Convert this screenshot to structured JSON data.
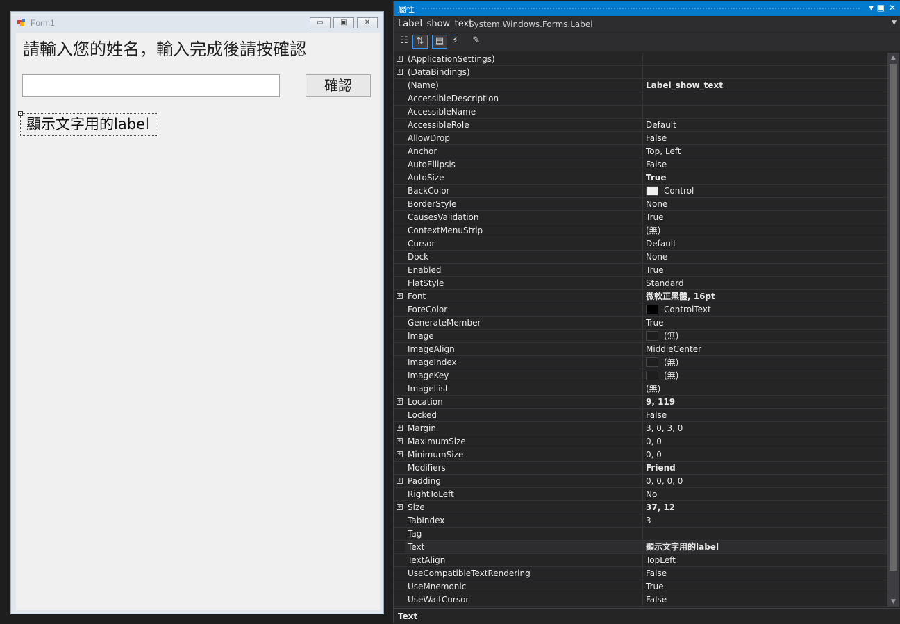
{
  "form": {
    "title": "Form1",
    "minimize_glyph": "▭",
    "maximize_glyph": "▣",
    "close_glyph": "✕",
    "prompt": "請輸入您的姓名，輸入完成後請按確認",
    "input_value": "",
    "confirm_label": "確認",
    "show_label": "顯示文字用的label"
  },
  "properties": {
    "panel_title": "屬性",
    "object_name": "Label_show_text",
    "object_type": "System.Windows.Forms.Label",
    "description_title": "Text",
    "rows": [
      {
        "name": "(ApplicationSettings)",
        "value": "",
        "expandable": true
      },
      {
        "name": "(DataBindings)",
        "value": "",
        "expandable": true
      },
      {
        "name": "(Name)",
        "value": "Label_show_text",
        "bold": true
      },
      {
        "name": "AccessibleDescription",
        "value": ""
      },
      {
        "name": "AccessibleName",
        "value": ""
      },
      {
        "name": "AccessibleRole",
        "value": "Default"
      },
      {
        "name": "AllowDrop",
        "value": "False"
      },
      {
        "name": "Anchor",
        "value": "Top, Left"
      },
      {
        "name": "AutoEllipsis",
        "value": "False"
      },
      {
        "name": "AutoSize",
        "value": "True",
        "bold": true
      },
      {
        "name": "BackColor",
        "value": "Control",
        "swatch": "#f0f0f0"
      },
      {
        "name": "BorderStyle",
        "value": "None"
      },
      {
        "name": "CausesValidation",
        "value": "True"
      },
      {
        "name": "ContextMenuStrip",
        "value": "(無)"
      },
      {
        "name": "Cursor",
        "value": "Default"
      },
      {
        "name": "Dock",
        "value": "None"
      },
      {
        "name": "Enabled",
        "value": "True"
      },
      {
        "name": "FlatStyle",
        "value": "Standard"
      },
      {
        "name": "Font",
        "value": "微軟正黑體, 16pt",
        "expandable": true,
        "bold": true
      },
      {
        "name": "ForeColor",
        "value": "ControlText",
        "swatch": "#000000"
      },
      {
        "name": "GenerateMember",
        "value": "True"
      },
      {
        "name": "Image",
        "value": "(無)",
        "swatch": "#1e1e1e"
      },
      {
        "name": "ImageAlign",
        "value": "MiddleCenter"
      },
      {
        "name": "ImageIndex",
        "value": "(無)",
        "swatch": "#1e1e1e"
      },
      {
        "name": "ImageKey",
        "value": "(無)",
        "swatch": "#1e1e1e"
      },
      {
        "name": "ImageList",
        "value": "(無)"
      },
      {
        "name": "Location",
        "value": "9, 119",
        "expandable": true,
        "bold": true
      },
      {
        "name": "Locked",
        "value": "False"
      },
      {
        "name": "Margin",
        "value": "3, 0, 3, 0",
        "expandable": true
      },
      {
        "name": "MaximumSize",
        "value": "0, 0",
        "expandable": true
      },
      {
        "name": "MinimumSize",
        "value": "0, 0",
        "expandable": true
      },
      {
        "name": "Modifiers",
        "value": "Friend",
        "bold": true
      },
      {
        "name": "Padding",
        "value": "0, 0, 0, 0",
        "expandable": true
      },
      {
        "name": "RightToLeft",
        "value": "No"
      },
      {
        "name": "Size",
        "value": "37, 12",
        "expandable": true,
        "bold": true
      },
      {
        "name": "TabIndex",
        "value": "3"
      },
      {
        "name": "Tag",
        "value": ""
      },
      {
        "name": "Text",
        "value": "顯示文字用的label",
        "bold": true,
        "selected": true
      },
      {
        "name": "TextAlign",
        "value": "TopLeft"
      },
      {
        "name": "UseCompatibleTextRendering",
        "value": "False"
      },
      {
        "name": "UseMnemonic",
        "value": "True"
      },
      {
        "name": "UseWaitCursor",
        "value": "False"
      }
    ]
  },
  "colors": {
    "accent": "#007acc",
    "panel_bg": "#252526",
    "form_bg": "#f0f0f0"
  }
}
